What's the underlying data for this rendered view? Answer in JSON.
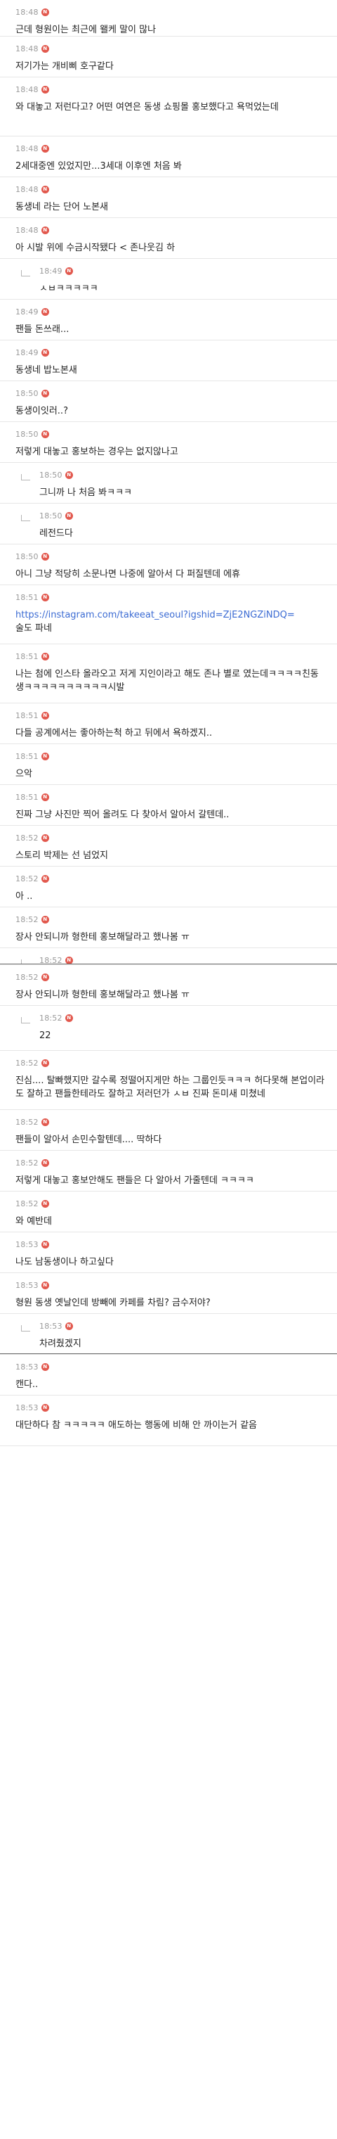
{
  "comments": [
    {
      "time": "18:48",
      "badge": "N",
      "reply": false,
      "text": "근데 형원이는 최근에 왤케 말이 많나"
    },
    {
      "time": "18:48",
      "badge": "N",
      "reply": false,
      "text": "저기가는 개비삐 호구같다"
    },
    {
      "time": "18:48",
      "badge": "N",
      "reply": false,
      "text": "와 대놓고 저런다고? 어떤 여연은 동생 쇼핑몰 홍보했다고 욕먹었는데"
    },
    {
      "time": "18:48",
      "badge": "N",
      "reply": false,
      "text": "2세대중엔 있었지만...3세대 이후엔 처음 봐"
    },
    {
      "time": "18:48",
      "badge": "N",
      "reply": false,
      "text": "동생네 라는 단어 노본새"
    },
    {
      "time": "18:48",
      "badge": "N",
      "reply": false,
      "text": "아 시발 위에 수금시작됐다 < 존나웃김 하"
    },
    {
      "time": "18:49",
      "badge": "N",
      "reply": true,
      "text": "ㅅㅂㅋㅋㅋㅋㅋ"
    },
    {
      "time": "18:49",
      "badge": "N",
      "reply": false,
      "text": "팬들 돈쓰래..."
    },
    {
      "time": "18:49",
      "badge": "N",
      "reply": false,
      "text": "동생네 밥노본새"
    },
    {
      "time": "18:50",
      "badge": "N",
      "reply": false,
      "text": "동생이잇러..?"
    },
    {
      "time": "18:50",
      "badge": "N",
      "reply": false,
      "text": "저렇게 대놓고 홍보하는 경우는 없지않나고"
    },
    {
      "time": "18:50",
      "badge": "N",
      "reply": true,
      "text": "그니까 나 처음 봐ㅋㅋㅋ"
    },
    {
      "time": "18:50",
      "badge": "N",
      "reply": true,
      "text": "레전드다"
    },
    {
      "time": "18:50",
      "badge": "N",
      "reply": false,
      "text": "아니 그냥 적당히 소문나면 나중에 알아서 다 퍼질텐데 에휴"
    },
    {
      "time": "18:51",
      "badge": "N",
      "reply": false,
      "text": "",
      "link": "https://instagram.com/takeeat_seoul?igshid=ZjE2NGZiNDQ=",
      "after": "술도 파네"
    },
    {
      "time": "18:51",
      "badge": "N",
      "reply": false,
      "text": "나는 첨에 인스타 올라오고 저게 지인이라고 해도 존나 별로 였는데ㅋㅋㅋㅋ친동생ㅋㅋㅋㅋㅋㅋㅋㅋㅋㅋ시발"
    },
    {
      "time": "18:51",
      "badge": "N",
      "reply": false,
      "text": "다들 공계에서는 좋아하는척 하고 뒤에서 욕하겠지.."
    },
    {
      "time": "18:51",
      "badge": "N",
      "reply": false,
      "text": "으악"
    },
    {
      "time": "18:51",
      "badge": "N",
      "reply": false,
      "text": "진짜 그냥 사진만 찍어 올려도 다 찾아서 알아서 갈텐데.."
    },
    {
      "time": "18:52",
      "badge": "N",
      "reply": false,
      "text": "스토리 박제는 선 넘었지"
    },
    {
      "time": "18:52",
      "badge": "N",
      "reply": false,
      "text": "아 .."
    },
    {
      "time": "18:52",
      "badge": "N",
      "reply": false,
      "text": "장사 안되니까 형한테 홍보해달라고 했나봄 ㅠ"
    },
    {
      "time": "18:52",
      "badge": "N",
      "reply": true,
      "text": "",
      "dark_bottom": true
    },
    {
      "time": "18:52",
      "badge": "N",
      "reply": false,
      "text": "장사 안되니까 형한테 홍보해달라고 했나봄 ㅠ"
    },
    {
      "time": "18:52",
      "badge": "N",
      "reply": true,
      "text": "22"
    },
    {
      "time": "18:52",
      "badge": "N",
      "reply": false,
      "text": "진심.... 탈빠했지만 갈수록 정떨어지게만 하는 그룹인듯ㅋㅋㅋ 허다못해 본업이라도 잘하고 팬들한테라도 잘하고 저러던가 ㅅㅂ 진짜 돈미새 미쳤네"
    },
    {
      "time": "18:52",
      "badge": "N",
      "reply": false,
      "text": "팬들이 알아서 손민수할텐데.... 딱하다"
    },
    {
      "time": "18:52",
      "badge": "N",
      "reply": false,
      "text": "저렇게 대놓고 홍보안해도 팬들은 다 알아서 가줄텐데 ㅋㅋㅋㅋ"
    },
    {
      "time": "18:52",
      "badge": "N",
      "reply": false,
      "text": "와 예반데"
    },
    {
      "time": "18:53",
      "badge": "N",
      "reply": false,
      "text": "나도 남동생이나 하고싶다"
    },
    {
      "time": "18:53",
      "badge": "N",
      "reply": false,
      "text": "형원 동생 옛날인데 방빼에 카페를 차림? 금수저야?"
    },
    {
      "time": "18:53",
      "badge": "N",
      "reply": true,
      "text": "차려줬겠지",
      "dark_bottom": true
    },
    {
      "time": "18:53",
      "badge": "N",
      "reply": false,
      "text": "캔다.."
    },
    {
      "time": "18:53",
      "badge": "N",
      "reply": false,
      "text": "대단하다 참 ㅋㅋㅋㅋㅋ 애도하는 행동에 비해 안 까이는거 같음"
    }
  ]
}
